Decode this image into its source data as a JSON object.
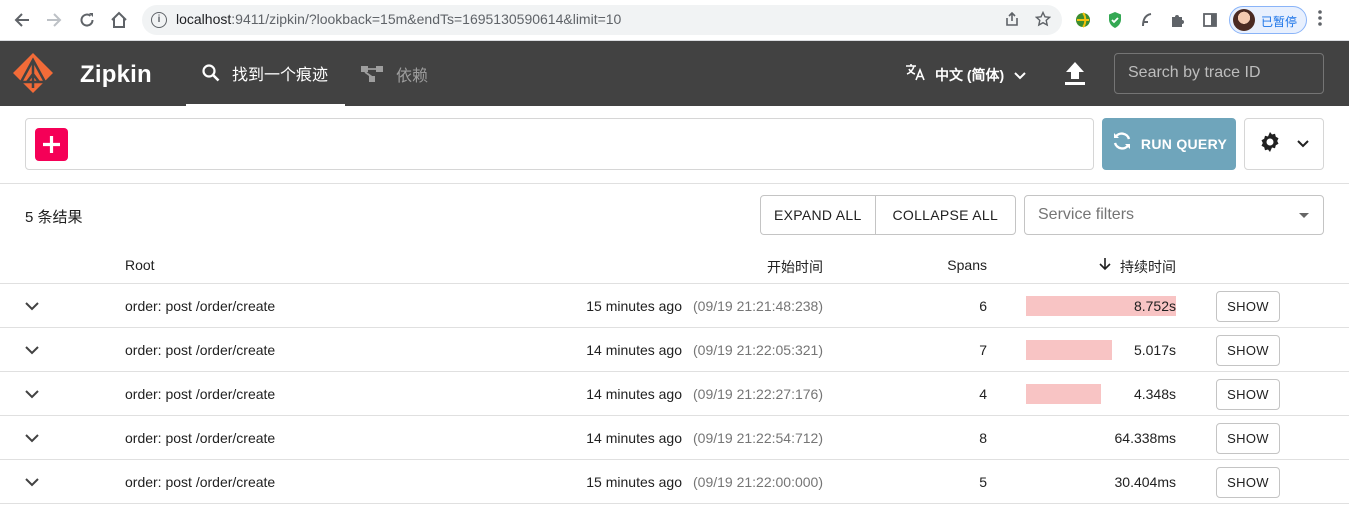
{
  "browser": {
    "url_host": "localhost",
    "url_rest": ":9411/zipkin/?lookback=15m&endTs=1695130590614&limit=10",
    "profile_label": "已暂停"
  },
  "header": {
    "brand": "Zipkin",
    "tabs": [
      {
        "label": "找到一个痕迹",
        "icon": "search-icon",
        "active": true
      },
      {
        "label": "依赖",
        "icon": "dependency-graph-icon",
        "active": false
      }
    ],
    "language": "中文 (简体)",
    "trace_search_placeholder": "Search by trace ID"
  },
  "query": {
    "run_label": "RUN QUERY"
  },
  "results": {
    "count_label": "5 条结果",
    "expand_all": "EXPAND ALL",
    "collapse_all": "COLLAPSE ALL",
    "service_filter_placeholder": "Service filters"
  },
  "table": {
    "columns": {
      "root": "Root",
      "start": "开始时间",
      "spans": "Spans",
      "duration": "持续时间"
    },
    "rows": [
      {
        "root": "order: post /order/create",
        "relative": "15 minutes ago",
        "absolute": "(09/19 21:21:48:238)",
        "spans": "6",
        "duration": "8.752s",
        "bar_fraction": 1.0,
        "show": "SHOW"
      },
      {
        "root": "order: post /order/create",
        "relative": "14 minutes ago",
        "absolute": "(09/19 21:22:05:321)",
        "spans": "7",
        "duration": "5.017s",
        "bar_fraction": 0.573,
        "show": "SHOW"
      },
      {
        "root": "order: post /order/create",
        "relative": "14 minutes ago",
        "absolute": "(09/19 21:22:27:176)",
        "spans": "4",
        "duration": "4.348s",
        "bar_fraction": 0.497,
        "show": "SHOW"
      },
      {
        "root": "order: post /order/create",
        "relative": "14 minutes ago",
        "absolute": "(09/19 21:22:54:712)",
        "spans": "8",
        "duration": "64.338ms",
        "bar_fraction": 0.0,
        "show": "SHOW"
      },
      {
        "root": "order: post /order/create",
        "relative": "15 minutes ago",
        "absolute": "(09/19 21:22:00:000)",
        "spans": "5",
        "duration": "30.404ms",
        "bar_fraction": 0.0,
        "show": "SHOW"
      }
    ]
  },
  "colors": {
    "appbar": "#424242",
    "add_button": "#f50057",
    "run_button": "#6fa5bb",
    "duration_bar": "#f8c4c4",
    "logo": "#f26b38"
  }
}
